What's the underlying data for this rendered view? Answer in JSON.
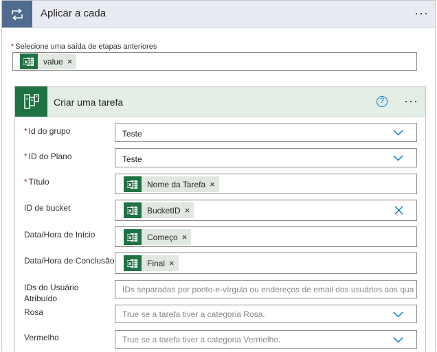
{
  "outer": {
    "title": "Aplicar a cada",
    "more": "···",
    "select_label": "Selecione uma saída de etapas anteriores",
    "select_required": "*",
    "token": {
      "label": "value",
      "remove": "×"
    }
  },
  "action": {
    "title": "Criar uma tarefa",
    "help": "?",
    "more": "···",
    "fields": {
      "group": {
        "required": "*",
        "label": "Id do grupo",
        "value": "Teste"
      },
      "plan": {
        "required": "*",
        "label": "ID do Plano",
        "value": "Teste"
      },
      "title": {
        "required": "*",
        "label": "Título",
        "token": "Nome da Tarefa",
        "remove": "×"
      },
      "bucket": {
        "label": "ID de bucket",
        "token": "BucketID",
        "remove": "×"
      },
      "start": {
        "label": "Data/Hora de Início",
        "token": "Começo",
        "remove": "×"
      },
      "due": {
        "label": "Data/Hora de Conclusão",
        "token": "Final",
        "remove": "×"
      },
      "assignees": {
        "label": "IDs do Usuário Atribuído",
        "placeholder": "IDs separadas por ponto-e-vírgula ou endereços de email dos usuários aos qua"
      },
      "pink": {
        "label": "Rosa",
        "placeholder": "True se a tarefa tiver a categoria Rosa."
      },
      "red": {
        "label": "Vermelho",
        "placeholder": "True se a tarefa tiver a categoria Vermelho."
      }
    }
  },
  "colors": {
    "loop_header": "#4f6b8f",
    "planner_green": "#1f7244",
    "accent_blue": "#0078d4",
    "required_red": "#a4262c"
  },
  "icons": {
    "loop": "loop-icon",
    "planner": "planner-icon",
    "excel": "excel-icon",
    "chevron": "chevron-down-icon",
    "clear": "clear-icon",
    "help": "help-icon"
  }
}
